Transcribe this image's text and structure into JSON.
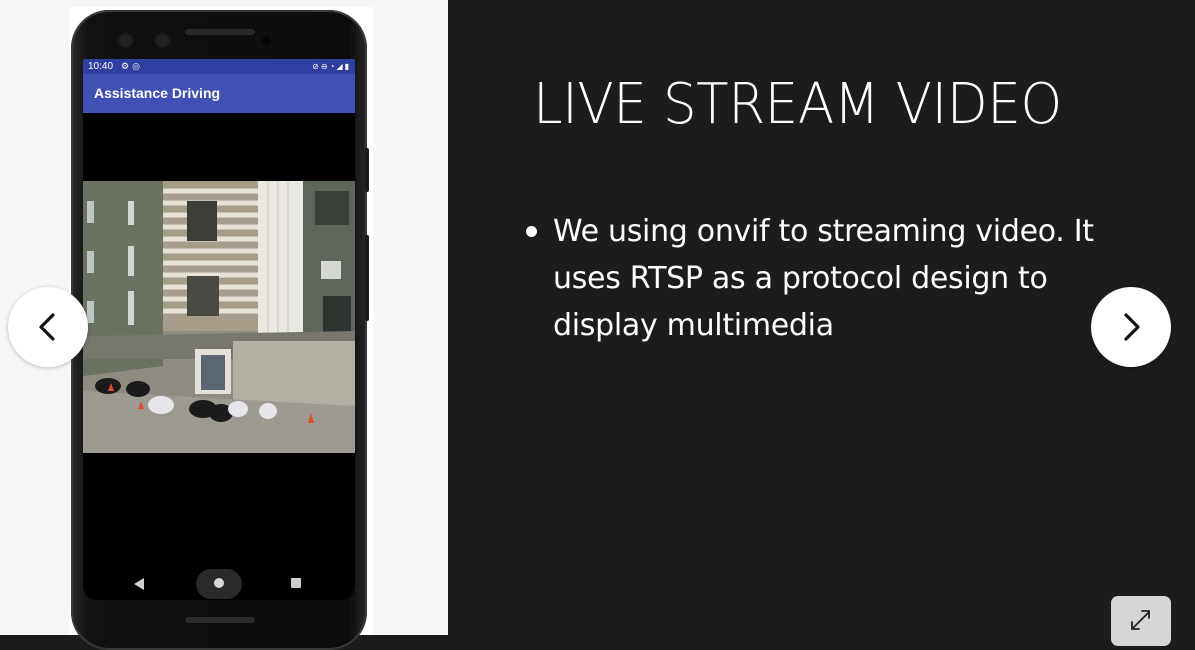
{
  "phone": {
    "status_bar": {
      "time": "10:40",
      "left_icons": [
        "gear-icon",
        "sync-icon"
      ],
      "right_icons": [
        "mute-icon",
        "dnd-icon",
        "wifi-icon",
        "signal-icon",
        "battery-icon"
      ]
    },
    "app_bar": {
      "title": "Assistance Driving",
      "color": "#3f51b5"
    },
    "video": {
      "description_icon": "camera-stream-image"
    },
    "nav_bar": {
      "buttons": [
        "back-icon",
        "home-icon",
        "recents-icon"
      ]
    }
  },
  "slide": {
    "title": "LIVE STREAM VIDEO",
    "bullets": [
      "We using onvif to streaming video. It uses RTSP as a protocol design to display multimedia"
    ],
    "background": "#1c1c1c"
  },
  "controls": {
    "prev_icon": "chevron-left-icon",
    "next_icon": "chevron-right-icon",
    "fullscreen_icon": "expand-icon"
  }
}
